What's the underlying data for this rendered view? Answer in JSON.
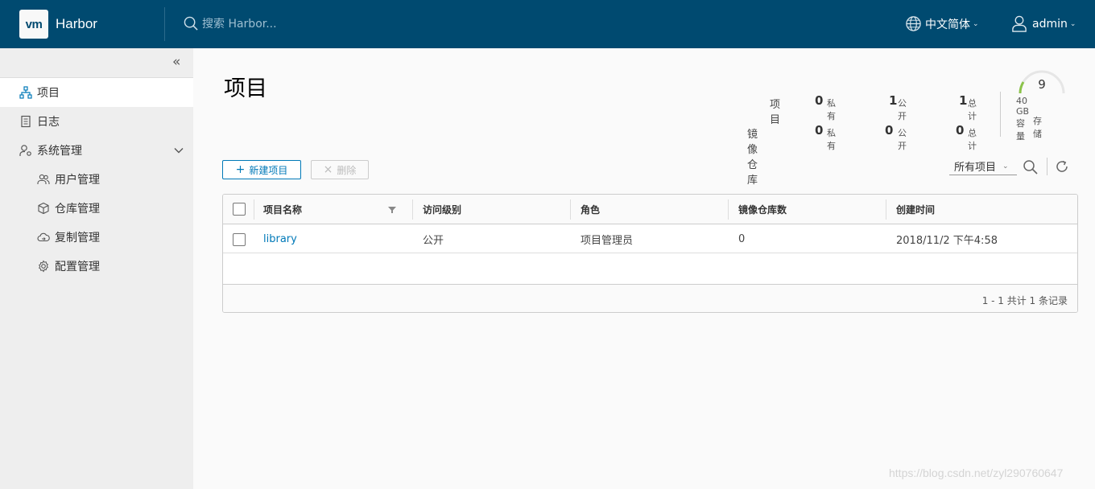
{
  "header": {
    "logo_text": "vm",
    "brand": "Harbor",
    "search_placeholder": "搜索 Harbor...",
    "language": "中文简体",
    "user": "admin"
  },
  "sidebar": {
    "items": [
      {
        "label": "项目",
        "icon": "project-icon",
        "active": true
      },
      {
        "label": "日志",
        "icon": "log-icon"
      },
      {
        "label": "系统管理",
        "icon": "system-admin-icon"
      },
      {
        "label": "用户管理",
        "icon": "users-icon"
      },
      {
        "label": "仓库管理",
        "icon": "registry-icon"
      },
      {
        "label": "复制管理",
        "icon": "replication-icon"
      },
      {
        "label": "配置管理",
        "icon": "config-icon"
      }
    ]
  },
  "main": {
    "title": "项目",
    "stats": {
      "project_label": "项目",
      "repo_label": "镜像仓库",
      "private_label": "私有",
      "public_label": "公开",
      "total_label": "总计",
      "project_private": "0",
      "project_public": "1",
      "project_total": "1",
      "repo_private": "0",
      "repo_public": "0",
      "repo_total": "0",
      "capacity_value": "9",
      "capacity_text": "40 GB 容量",
      "storage_text": "存储"
    },
    "toolbar": {
      "new_project": "新建项目",
      "delete": "删除",
      "filter": "所有项目"
    },
    "table": {
      "headers": [
        "项目名称",
        "访问级别",
        "角色",
        "镜像仓库数",
        "创建时间"
      ],
      "rows": [
        {
          "name": "library",
          "access": "公开",
          "role": "项目管理员",
          "repos": "0",
          "created": "2018/11/2 下午4:58"
        }
      ],
      "footer": "1 - 1 共计 1 条记录"
    }
  },
  "watermark": "https://blog.csdn.net/zyl290760647"
}
